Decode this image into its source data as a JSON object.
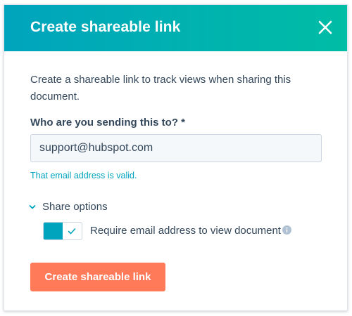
{
  "dialog": {
    "title": "Create shareable link",
    "close_icon": "close-icon"
  },
  "body": {
    "description": "Create a shareable link to track views when sharing this document.",
    "recipient_label": "Who are you sending this to? *",
    "email_value": "support@hubspot.com",
    "validation_message": "That email address is valid."
  },
  "share_options": {
    "label": "Share options",
    "expanded": true,
    "require_email": {
      "label": "Require email address to view document",
      "enabled": true,
      "info_icon": "info-icon"
    }
  },
  "actions": {
    "create_label": "Create shareable link"
  },
  "colors": {
    "header_start": "#00a4bd",
    "header_end": "#00bda5",
    "primary_button": "#ff7a59",
    "valid_text": "#00a4bd",
    "toggle_on": "#00a4bd",
    "text": "#33475b"
  }
}
